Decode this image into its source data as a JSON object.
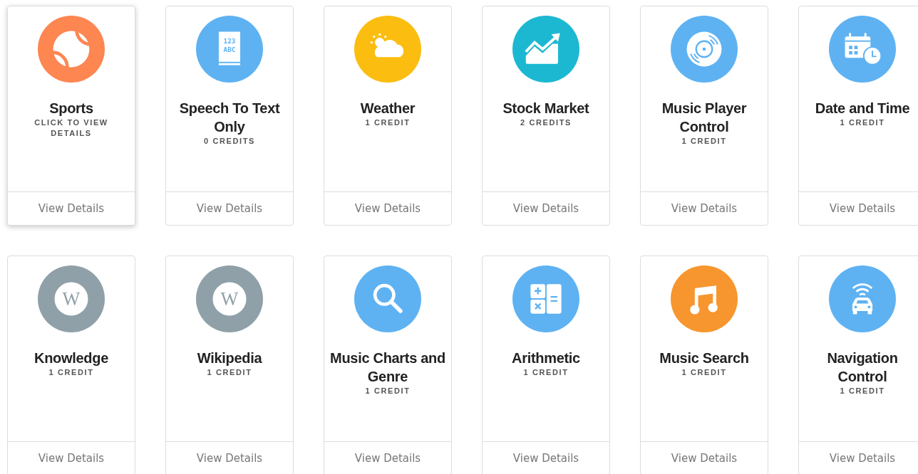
{
  "rows": [
    {
      "cards": [
        {
          "title": "Sports",
          "subtitle": "CLICK TO VIEW DETAILS",
          "hovered": true,
          "icon": {
            "kind": "ball",
            "color": "#fd8651"
          },
          "action": "View Details"
        },
        {
          "title": "Speech To Text Only",
          "subtitle": "0 CREDITS",
          "hovered": false,
          "icon": {
            "kind": "book",
            "color": "#5eb2f2",
            "text": [
              "123",
              "ABC"
            ]
          },
          "action": "View Details"
        },
        {
          "title": "Weather",
          "subtitle": "1 CREDIT",
          "hovered": false,
          "icon": {
            "kind": "weather",
            "color": "#fbbd10"
          },
          "action": "View Details"
        },
        {
          "title": "Stock Market",
          "subtitle": "2 CREDITS",
          "hovered": false,
          "icon": {
            "kind": "stock",
            "color": "#1cb8d2"
          },
          "action": "View Details"
        },
        {
          "title": "Music Player Control",
          "subtitle": "1 CREDIT",
          "hovered": false,
          "icon": {
            "kind": "disc",
            "color": "#5eb2f2"
          },
          "action": "View Details"
        },
        {
          "title": "Date and Time",
          "subtitle": "1 CREDIT",
          "hovered": false,
          "icon": {
            "kind": "calendar",
            "color": "#5eb2f2"
          },
          "action": "View Details"
        }
      ]
    },
    {
      "cards": [
        {
          "title": "Knowledge",
          "subtitle": "1 CREDIT",
          "hovered": false,
          "icon": {
            "kind": "wiki",
            "color": "#8fa0a8",
            "text": [
              "W"
            ]
          },
          "action": "View Details"
        },
        {
          "title": "Wikipedia",
          "subtitle": "1 CREDIT",
          "hovered": false,
          "icon": {
            "kind": "wiki",
            "color": "#8fa0a8",
            "text": [
              "W"
            ]
          },
          "action": "View Details"
        },
        {
          "title": "Music Charts and Genre",
          "subtitle": "1 CREDIT",
          "hovered": false,
          "icon": {
            "kind": "search",
            "color": "#5eb2f2"
          },
          "action": "View Details"
        },
        {
          "title": "Arithmetic",
          "subtitle": "1 CREDIT",
          "hovered": false,
          "icon": {
            "kind": "calculator",
            "color": "#5eb2f2"
          },
          "action": "View Details"
        },
        {
          "title": "Music Search",
          "subtitle": "1 CREDIT",
          "hovered": false,
          "icon": {
            "kind": "note",
            "color": "#f7962f"
          },
          "action": "View Details"
        },
        {
          "title": "Navigation Control",
          "subtitle": "1 CREDIT",
          "hovered": false,
          "icon": {
            "kind": "car",
            "color": "#5eb2f2"
          },
          "action": "View Details"
        }
      ]
    }
  ]
}
